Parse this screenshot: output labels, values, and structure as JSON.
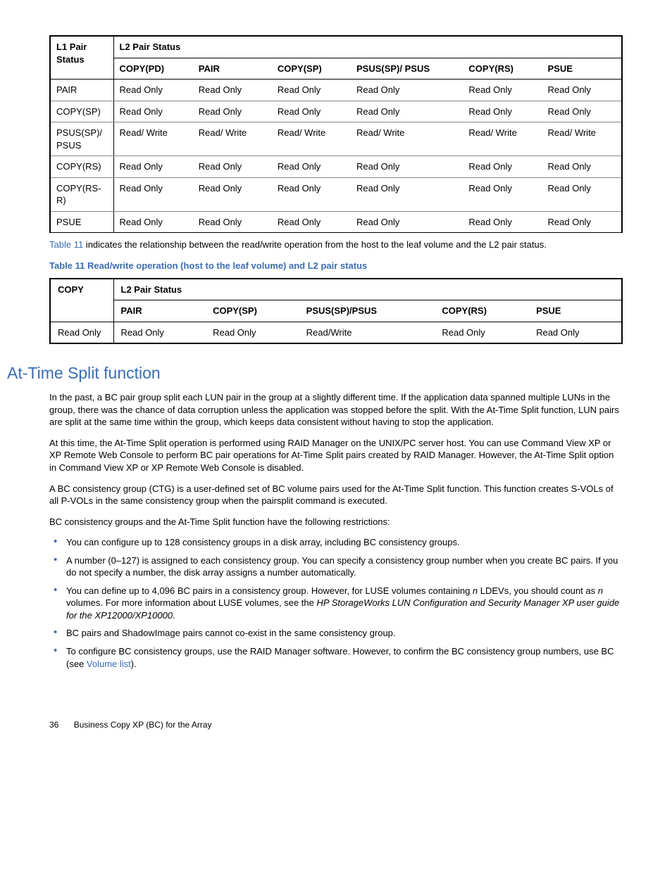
{
  "table1": {
    "l1Header": "L1 Pair Status",
    "l2Header": "L2 Pair Status",
    "cols": [
      "COPY(PD)",
      "PAIR",
      "COPY(SP)",
      "PSUS(SP)/ PSUS",
      "COPY(RS)",
      "PSUE"
    ],
    "rows": [
      {
        "label": "PAIR",
        "cells": [
          "Read Only",
          "Read Only",
          "Read Only",
          "Read Only",
          "Read Only",
          "Read Only"
        ]
      },
      {
        "label": "COPY(SP)",
        "cells": [
          "Read Only",
          "Read Only",
          "Read Only",
          "Read Only",
          "Read Only",
          "Read Only"
        ]
      },
      {
        "label": "PSUS(SP)/ PSUS",
        "cells": [
          "Read/ Write",
          "Read/ Write",
          "Read/ Write",
          "Read/ Write",
          "Read/ Write",
          "Read/ Write"
        ]
      },
      {
        "label": "COPY(RS)",
        "cells": [
          "Read Only",
          "Read Only",
          "Read Only",
          "Read Only",
          "Read Only",
          "Read Only"
        ]
      },
      {
        "label": "COPY(RS-R)",
        "cells": [
          "Read Only",
          "Read Only",
          "Read Only",
          "Read Only",
          "Read Only",
          "Read Only"
        ]
      },
      {
        "label": "PSUE",
        "cells": [
          "Read Only",
          "Read Only",
          "Read Only",
          "Read Only",
          "Read Only",
          "Read Only"
        ]
      }
    ]
  },
  "interText": {
    "linkText": "Table 11",
    "after": " indicates the relationship between the read/write operation from the host to the leaf volume and the L2 pair status."
  },
  "caption": "Table 11 Read/write operation (host to the leaf volume) and L2 pair status",
  "table2": {
    "copyHeader": "COPY",
    "l2Header": "L2 Pair Status",
    "cols": [
      "PAIR",
      "COPY(SP)",
      "PSUS(SP)/PSUS",
      "COPY(RS)",
      "PSUE"
    ],
    "row": {
      "label": "Read Only",
      "cells": [
        "Read Only",
        "Read Only",
        "Read/Write",
        "Read Only",
        "Read Only"
      ]
    }
  },
  "sectionTitle": "At-Time Split function",
  "paras": {
    "p1": "In the past, a BC pair group split each LUN pair in the group at a slightly different time. If the application data spanned multiple LUNs in the group, there was the chance of data corruption unless the application was stopped before the split. With the At-Time Split function, LUN pairs are split at the same time within the group, which keeps data consistent without having to stop the application.",
    "p2": "At this time, the At-Time Split operation is performed using RAID Manager on the UNIX/PC server host. You can use Command View XP or XP Remote Web Console to perform BC pair operations for At-Time Split pairs created by RAID Manager. However, the At-Time Split option in Command View XP or XP Remote Web Console is disabled.",
    "p3": "A BC consistency group (CTG) is a user-defined set of BC volume pairs used for the At-Time Split function. This function creates S-VOLs of all P-VOLs in the same consistency group when the pairsplit command is executed.",
    "p4": "BC consistency groups and the At-Time Split function have the following restrictions:"
  },
  "bullets": {
    "b1": "You can configure up to 128 consistency groups in a disk array, including BC consistency groups.",
    "b2": "A number (0–127) is assigned to each consistency group. You can specify a consistency group number when you create BC pairs. If you do not specify a number, the disk array assigns a number automatically.",
    "b3a": "You can define up to 4,096 BC pairs in a consistency group. However, for LUSE volumes containing ",
    "b3b": "n",
    "b3c": " LDEVs, you should count as ",
    "b3d": "n",
    "b3e": " volumes. For more information about LUSE volumes, see the ",
    "b3f": "HP StorageWorks LUN Configuration and Security Manager XP user guide for the XP12000/XP10000",
    "b3g": ".",
    "b4": "BC pairs and ShadowImage pairs cannot co-exist in the same consistency group.",
    "b5a": "To configure BC consistency groups, use the RAID Manager software. However, to confirm the BC consistency group numbers, use BC (see ",
    "b5link": "Volume list",
    "b5b": ")."
  },
  "footer": {
    "pageNum": "36",
    "title": "Business Copy XP (BC) for the Array"
  }
}
